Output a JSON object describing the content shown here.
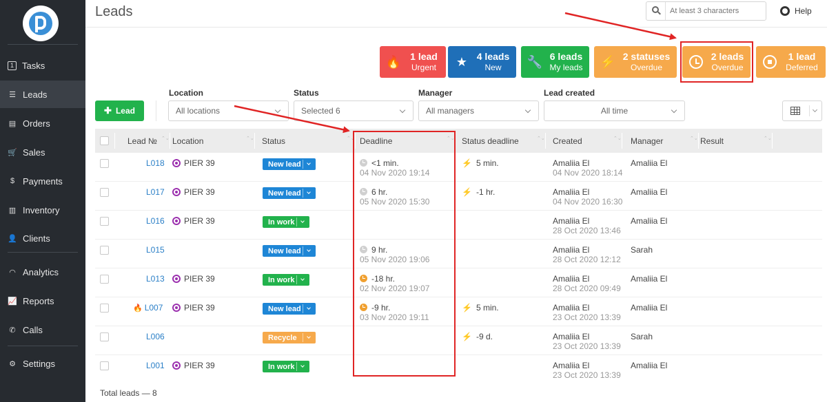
{
  "app": {
    "title": "Leads"
  },
  "nav": [
    {
      "label": "Tasks",
      "icon": "tasks-icon",
      "glyph": "1"
    },
    {
      "label": "Leads",
      "icon": "filter-icon",
      "glyph": "☰"
    },
    {
      "label": "Orders",
      "icon": "orders-icon",
      "glyph": "▤"
    },
    {
      "label": "Sales",
      "icon": "cart-icon",
      "glyph": "🛒"
    },
    {
      "label": "Payments",
      "icon": "dollar-icon",
      "glyph": "$"
    },
    {
      "label": "Inventory",
      "icon": "barcode-icon",
      "glyph": "▥"
    },
    {
      "label": "Clients",
      "icon": "clients-icon",
      "glyph": "👤"
    },
    {
      "label": "Analytics",
      "icon": "gauge-icon",
      "glyph": "◠"
    },
    {
      "label": "Reports",
      "icon": "chart-icon",
      "glyph": "📈"
    },
    {
      "label": "Calls",
      "icon": "phone-icon",
      "glyph": "✆"
    },
    {
      "label": "Settings",
      "icon": "gear-icon",
      "glyph": "⚙"
    }
  ],
  "search": {
    "placeholder": "At least 3 characters"
  },
  "help": {
    "label": "Help"
  },
  "tiles": [
    {
      "main": "1 lead",
      "sub": "Urgent",
      "color": "#f0504f",
      "icon": "fire-icon"
    },
    {
      "main": "4 leads",
      "sub": "New",
      "color": "#1f6fb8",
      "icon": "star-icon"
    },
    {
      "main": "6 leads",
      "sub": "My leads",
      "color": "#22b24c",
      "icon": "wrench-icon"
    },
    {
      "main": "2 statuses",
      "sub": "Overdue",
      "color": "#f6a94b",
      "icon": "bolt-icon"
    },
    {
      "main": "2 leads",
      "sub": "Overdue",
      "color": "#f6a94b",
      "icon": "clock-icon"
    },
    {
      "main": "1 lead",
      "sub": "Deferred",
      "color": "#f6a94b",
      "icon": "stop-icon"
    }
  ],
  "add_button": {
    "label": "Lead",
    "icon": "plus-icon"
  },
  "filters": {
    "location": {
      "label": "Location",
      "value": "All locations"
    },
    "status": {
      "label": "Status",
      "value": "Selected 6"
    },
    "manager": {
      "label": "Manager",
      "value": "All managers"
    },
    "created": {
      "label": "Lead created",
      "value": "All time"
    }
  },
  "columns": [
    "Lead №",
    "Location",
    "Status",
    "Deadline",
    "Status deadline",
    "Created",
    "Manager",
    "Result"
  ],
  "status_colors": {
    "New lead": "#1e86d6",
    "In work": "#22b24c",
    "Recycle": "#f6a94b"
  },
  "rows": [
    {
      "id": "L018",
      "urgent": false,
      "location": "PIER 39",
      "status": "New lead",
      "deadline": "<1 min.",
      "deadline_date": "04 Nov 2020 19:14",
      "deadline_overdue": false,
      "status_deadline": "5 min.",
      "sd_overdue": false,
      "created_by": "Amaliia El",
      "created": "04 Nov 2020 18:14",
      "manager": "Amaliia El"
    },
    {
      "id": "L017",
      "urgent": false,
      "location": "PIER 39",
      "status": "New lead",
      "deadline": "6 hr.",
      "deadline_date": "05 Nov 2020 15:30",
      "deadline_overdue": false,
      "status_deadline": "-1 hr.",
      "sd_overdue": true,
      "created_by": "Amaliia El",
      "created": "04 Nov 2020 16:30",
      "manager": "Amaliia El"
    },
    {
      "id": "L016",
      "urgent": false,
      "location": "PIER 39",
      "status": "In work",
      "deadline": "",
      "deadline_date": "",
      "deadline_overdue": false,
      "status_deadline": "",
      "sd_overdue": false,
      "created_by": "Amaliia El",
      "created": "28 Oct 2020 13:46",
      "manager": "Amaliia El"
    },
    {
      "id": "L015",
      "urgent": false,
      "location": "",
      "status": "New lead",
      "deadline": "9 hr.",
      "deadline_date": "05 Nov 2020 19:06",
      "deadline_overdue": false,
      "status_deadline": "",
      "sd_overdue": false,
      "created_by": "Amaliia El",
      "created": "28 Oct 2020 12:12",
      "manager": "Sarah"
    },
    {
      "id": "L013",
      "urgent": false,
      "location": "PIER 39",
      "status": "In work",
      "deadline": "-18 hr.",
      "deadline_date": "02 Nov 2020 19:07",
      "deadline_overdue": true,
      "status_deadline": "",
      "sd_overdue": false,
      "created_by": "Amaliia El",
      "created": "28 Oct 2020 09:49",
      "manager": "Amaliia El"
    },
    {
      "id": "L007",
      "urgent": true,
      "location": "PIER 39",
      "status": "New lead",
      "deadline": "-9 hr.",
      "deadline_date": "03 Nov 2020 19:11",
      "deadline_overdue": true,
      "status_deadline": "5 min.",
      "sd_overdue": false,
      "created_by": "Amaliia El",
      "created": "23 Oct 2020 13:39",
      "manager": "Amaliia El"
    },
    {
      "id": "L006",
      "urgent": false,
      "location": "",
      "status": "Recycle",
      "deadline": "",
      "deadline_date": "",
      "deadline_overdue": false,
      "status_deadline": "-9 d.",
      "sd_overdue": true,
      "created_by": "Amaliia El",
      "created": "23 Oct 2020 13:39",
      "manager": "Sarah"
    },
    {
      "id": "L001",
      "urgent": false,
      "location": "PIER 39",
      "status": "In work",
      "deadline": "",
      "deadline_date": "",
      "deadline_overdue": false,
      "status_deadline": "",
      "sd_overdue": false,
      "created_by": "Amaliia El",
      "created": "23 Oct 2020 13:39",
      "manager": "Amaliia El"
    }
  ],
  "footer": {
    "total": "Total leads — 8"
  }
}
